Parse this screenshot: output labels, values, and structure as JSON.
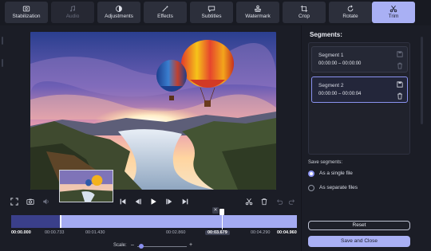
{
  "toolbar": {
    "tools": [
      {
        "label": "Stabilization",
        "icon": "stabilization-icon",
        "state": "normal"
      },
      {
        "label": "Audio",
        "icon": "music-note-icon",
        "state": "disabled"
      },
      {
        "label": "Adjustments",
        "icon": "adjustments-icon",
        "state": "normal"
      },
      {
        "label": "Effects",
        "icon": "magic-wand-icon",
        "state": "normal"
      },
      {
        "label": "Subtitles",
        "icon": "speech-bubble-icon",
        "state": "normal"
      },
      {
        "label": "Watermark",
        "icon": "stamp-icon",
        "state": "normal"
      },
      {
        "label": "Crop",
        "icon": "crop-icon",
        "state": "normal"
      },
      {
        "label": "Rotate",
        "icon": "rotate-icon",
        "state": "normal"
      },
      {
        "label": "Trim",
        "icon": "scissors-icon",
        "state": "active"
      }
    ]
  },
  "preview": {
    "description_icon": "hot-air-balloons-landscape"
  },
  "timeline": {
    "ticks": [
      "00:00.000",
      "00:00.733",
      "00:01.430",
      "00:02.860",
      "00:03.679",
      "00:04.290",
      "00:04.960"
    ],
    "current_time": "00:03.679"
  },
  "scale": {
    "label": "Scale:",
    "minus": "–",
    "plus": "+"
  },
  "panel": {
    "title": "Segments:",
    "segments": [
      {
        "name": "Segment 1",
        "range": "00:00:00 – 00:00:00",
        "active": false
      },
      {
        "name": "Segment 2",
        "range": "00:00:00 – 00:00:04",
        "active": true
      }
    ],
    "save_segments_label": "Save segments:",
    "options": [
      {
        "label": "As a single file",
        "selected": true
      },
      {
        "label": "As separate files",
        "selected": false
      }
    ],
    "reset_label": "Reset",
    "save_close_label": "Save and Close"
  },
  "colors": {
    "accent": "#a9b0f4",
    "selection": "#a4abf2",
    "background": "#1b1d26"
  }
}
